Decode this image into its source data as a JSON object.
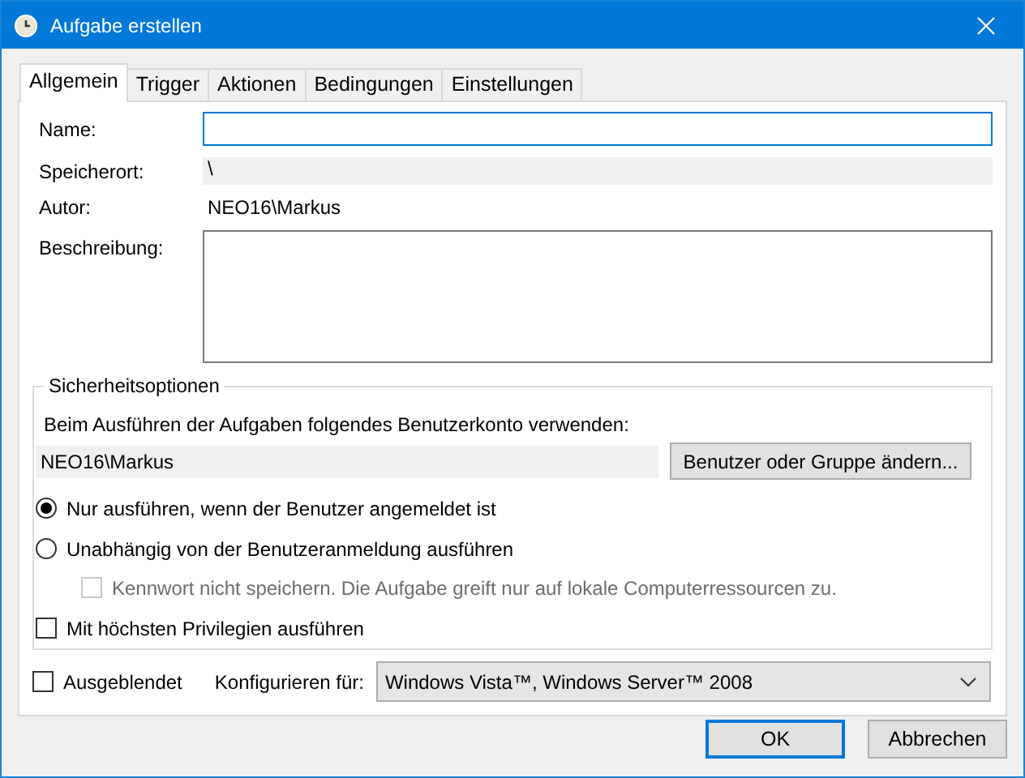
{
  "window": {
    "title": "Aufgabe erstellen"
  },
  "tabs": [
    {
      "label": "Allgemein",
      "selected": true
    },
    {
      "label": "Trigger",
      "selected": false
    },
    {
      "label": "Aktionen",
      "selected": false
    },
    {
      "label": "Bedingungen",
      "selected": false
    },
    {
      "label": "Einstellungen",
      "selected": false
    }
  ],
  "general": {
    "name": {
      "label": "Name:",
      "focused": true
    },
    "location": {
      "label": "Speicherort:",
      "value": "\\"
    },
    "author": {
      "label": "Autor:",
      "value": "NEO16\\Markus"
    },
    "description": {
      "label": "Beschreibung:"
    }
  },
  "security": {
    "title": "Sicherheitsoptionen",
    "account_prompt": "Beim Ausführen der Aufgaben folgendes Benutzerkonto verwenden:",
    "account": "NEO16\\Markus",
    "change_button": "Benutzer oder Gruppe ändern...",
    "options": [
      {
        "kind": "radio",
        "label": "Nur ausführen, wenn der Benutzer angemeldet ist",
        "selected": true
      },
      {
        "kind": "radio",
        "label": "Unabhängig von der Benutzeranmeldung ausführen",
        "selected": false,
        "children": [
          {
            "kind": "checkbox",
            "label": "Kennwort nicht speichern. Die Aufgabe greift nur auf lokale Computerressourcen zu.",
            "checked": false,
            "disabled": true
          }
        ]
      },
      {
        "kind": "checkbox",
        "label": "Mit höchsten Privilegien ausführen",
        "checked": false
      }
    ]
  },
  "hidden": {
    "label": "Ausgeblendet",
    "checked": false
  },
  "configure": {
    "label": "Konfigurieren für:",
    "value": "Windows Vista™, Windows Server™ 2008"
  },
  "buttons": [
    {
      "label": "OK",
      "default": true
    },
    {
      "label": "Abbrechen",
      "default": false
    }
  ]
}
